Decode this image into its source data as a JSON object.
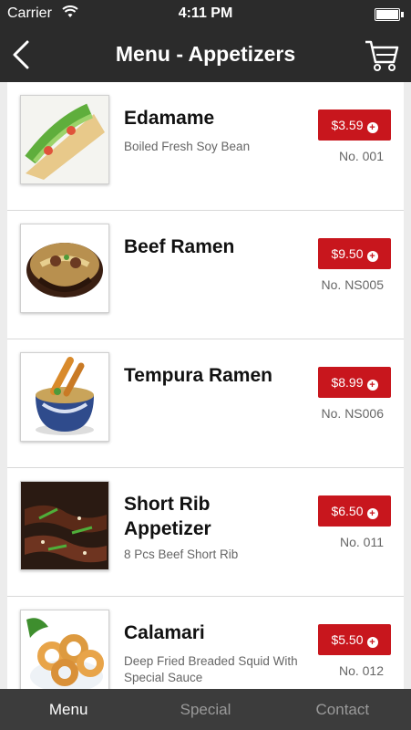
{
  "status": {
    "carrier": "Carrier",
    "time": "4:11 PM"
  },
  "nav": {
    "title": "Menu - Appetizers"
  },
  "items": [
    {
      "name": "Edamame",
      "desc": "Boiled Fresh Soy Bean",
      "price": "$3.59",
      "code": "No. 001"
    },
    {
      "name": "Beef Ramen",
      "desc": "",
      "price": "$9.50",
      "code": "No. NS005"
    },
    {
      "name": "Tempura Ramen",
      "desc": "",
      "price": "$8.99",
      "code": "No. NS006"
    },
    {
      "name": "Short Rib Appetizer",
      "desc": "8 Pcs Beef Short Rib",
      "price": "$6.50",
      "code": "No. 011"
    },
    {
      "name": "Calamari",
      "desc": "Deep Fried Breaded Squid With Special Sauce",
      "price": "$5.50",
      "code": "No. 012"
    }
  ],
  "tabs": [
    {
      "label": "Menu"
    },
    {
      "label": "Special"
    },
    {
      "label": "Contact"
    }
  ]
}
